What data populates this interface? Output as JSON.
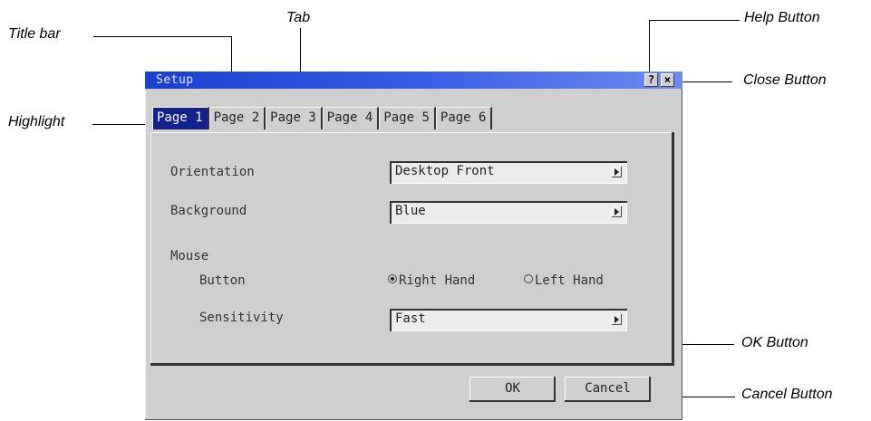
{
  "callouts": {
    "title_bar": "Title bar",
    "tab": "Tab",
    "help_button": "Help Button",
    "close_button": "Close Button",
    "highlight": "Highlight",
    "ok_button": "OK Button",
    "cancel_button": "Cancel Button"
  },
  "window": {
    "title": "Setup",
    "help_glyph": "?",
    "close_glyph": "×"
  },
  "tabs": [
    {
      "label": "Page 1",
      "active": true
    },
    {
      "label": "Page 2"
    },
    {
      "label": "Page 3"
    },
    {
      "label": "Page 4"
    },
    {
      "label": "Page 5"
    },
    {
      "label": "Page 6"
    }
  ],
  "settings": {
    "orientation": {
      "label": "Orientation",
      "value": "Desktop Front"
    },
    "background": {
      "label": "Background",
      "value": "Blue"
    },
    "mouse": {
      "label": "Mouse",
      "button_label": "Button",
      "options": [
        {
          "label": "Right Hand",
          "selected": true
        },
        {
          "label": "Left Hand",
          "selected": false
        }
      ],
      "sensitivity_label": "Sensitivity",
      "sensitivity_value": "Fast"
    }
  },
  "buttons": {
    "ok": "OK",
    "cancel": "Cancel"
  },
  "colors": {
    "titlebar": "#1a3fd1",
    "highlight": "#12218c"
  }
}
